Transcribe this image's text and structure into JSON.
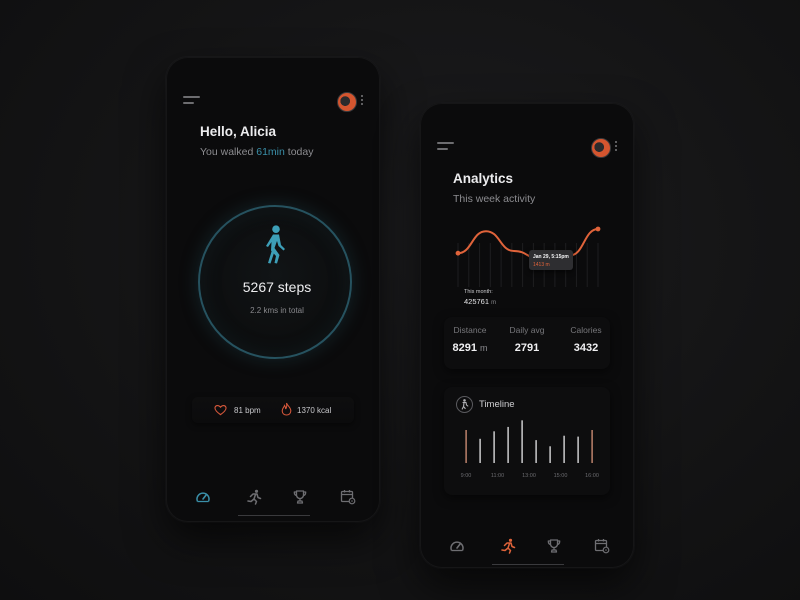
{
  "colors": {
    "accent_teal": "#3a8fa8",
    "accent_orange": "#e0633a",
    "background": "#141415",
    "phone": "#0b0b0c"
  },
  "home": {
    "greeting": "Hello, Alicia",
    "walked_prefix": "You walked",
    "walked_value": "61min",
    "walked_suffix": "today",
    "steps": "5267 steps",
    "distance_total": "2.2 kms in total",
    "heart_rate": "81 bpm",
    "calories": "1370 kcal",
    "icons": {
      "walker": "walking-person-icon",
      "heart": "heart-icon",
      "flame": "flame-icon"
    }
  },
  "analytics": {
    "title": "Analytics",
    "subtitle": "This week activity",
    "tooltip_date": "Jan 29, 5:15pm",
    "tooltip_value": "1413 m",
    "month_label": "This month:",
    "month_value": "425761",
    "month_unit": "m",
    "metrics": [
      {
        "label": "Distance",
        "value": "8291",
        "unit": "m"
      },
      {
        "label": "Daily avg",
        "value": "2791",
        "unit": ""
      },
      {
        "label": "Calories",
        "value": "3432",
        "unit": ""
      }
    ],
    "timeline_title": "Timeline",
    "timeline_ticks": [
      "9:00",
      "11:00",
      "13:00",
      "15:00",
      "16:00"
    ]
  },
  "chart_data": [
    {
      "type": "line",
      "title": "",
      "points": [
        0.45,
        0.95,
        0.5,
        0.3,
        0.4,
        1.0
      ],
      "highlight_index": 3
    },
    {
      "type": "bar",
      "title": "Timeline",
      "categories": [
        "9:00",
        "11:00",
        "13:00",
        "15:00",
        "16:00"
      ],
      "values": [
        0.75,
        0.55,
        0.72,
        0.82,
        0.97,
        0.52,
        0.38,
        0.62,
        0.6,
        0.75
      ],
      "highlight_indices": [
        0,
        9
      ]
    }
  ],
  "tabs": [
    {
      "name": "dashboard",
      "icon": "speedometer-icon"
    },
    {
      "name": "activity",
      "icon": "running-person-icon"
    },
    {
      "name": "achievements",
      "icon": "trophy-icon"
    },
    {
      "name": "schedule",
      "icon": "calendar-settings-icon"
    }
  ]
}
